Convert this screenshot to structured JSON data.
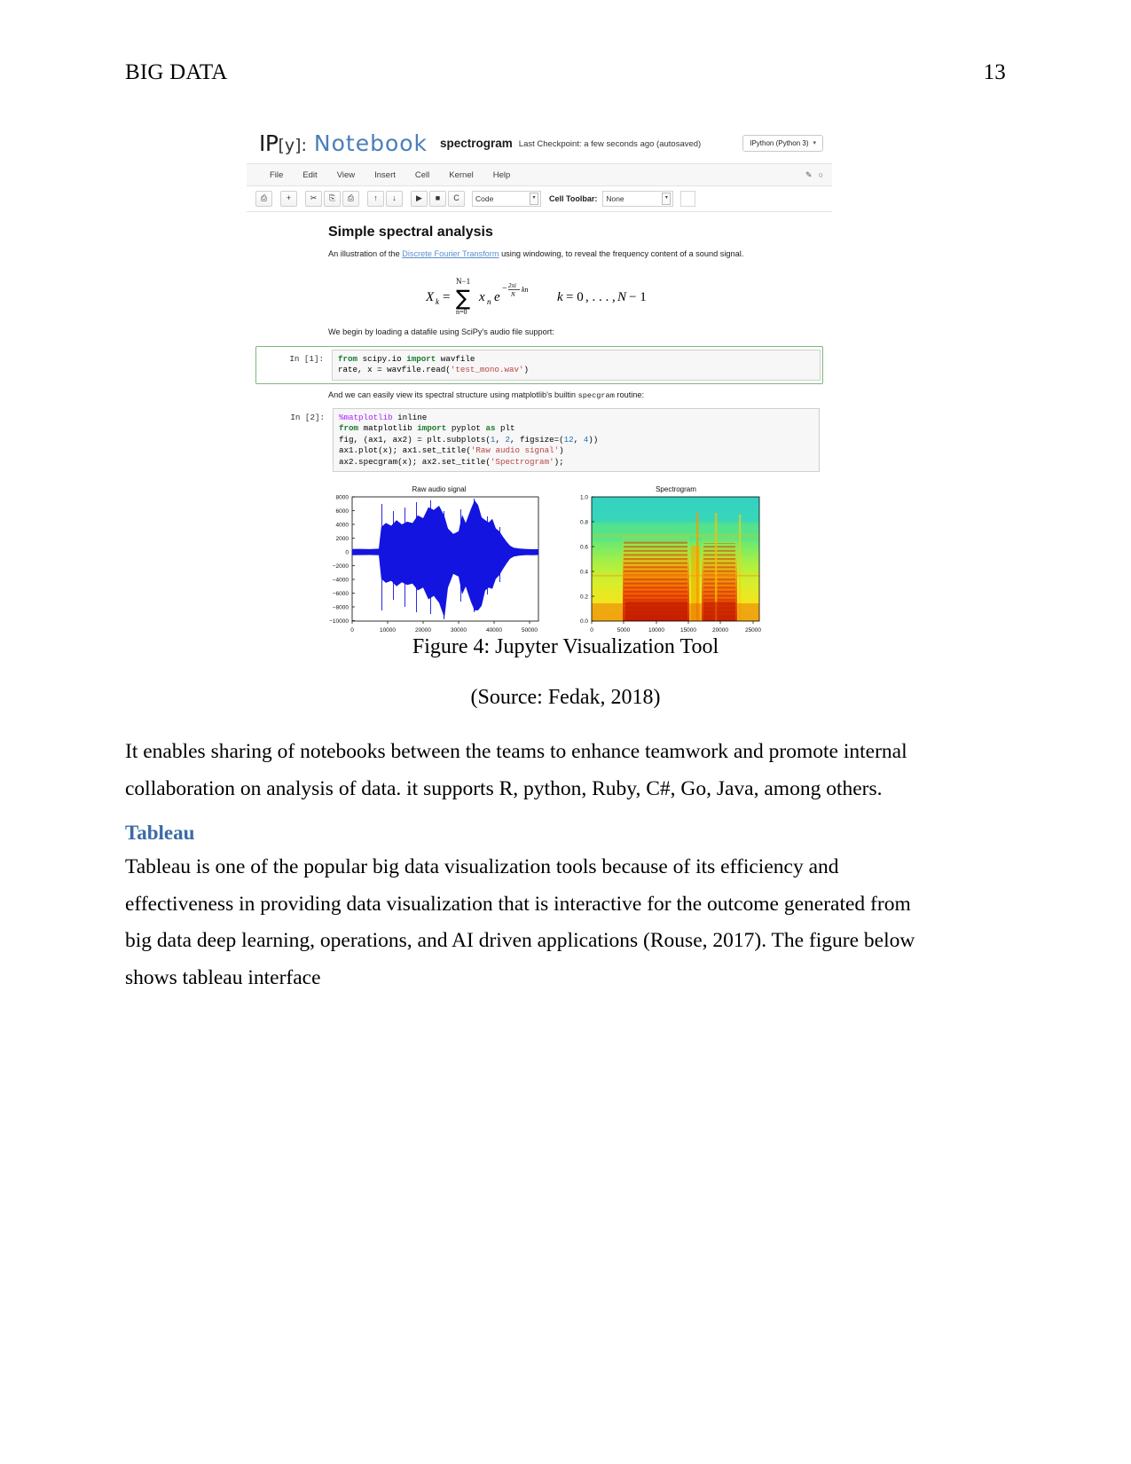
{
  "page": {
    "running_head": "BIG DATA",
    "page_number": "13"
  },
  "figure": {
    "caption": "Figure 4: Jupyter Visualization Tool",
    "source": "(Source: Fedak, 2018)",
    "notebook": {
      "logo_ip": "IP",
      "logo_bracket": "[y]:",
      "logo_word": "Notebook",
      "name": "spectrogram",
      "checkpoint": "Last Checkpoint: a few seconds ago (autosaved)",
      "kernel": "IPython (Python 3)",
      "kernel_caret": "▾",
      "menu": [
        "File",
        "Edit",
        "View",
        "Insert",
        "Cell",
        "Kernel",
        "Help"
      ],
      "tools_icons": [
        "pencil-icon",
        "circle-icon"
      ],
      "toolbar": {
        "buttons": [
          "save-icon",
          "add-icon",
          "cut-icon",
          "copy-icon",
          "paste-icon",
          "move-up-icon",
          "move-down-icon",
          "run-icon",
          "stop-icon",
          "restart-icon"
        ],
        "button_glyphs": [
          "⎙",
          "+",
          "✂",
          "⎘",
          "⎙",
          "↑",
          "↓",
          "▶",
          "■",
          "C"
        ],
        "cell_type": "Code",
        "cell_toolbar_label": "Cell Toolbar:",
        "cell_toolbar_value": "None"
      },
      "content": {
        "heading": "Simple spectral analysis",
        "intro_before": "An illustration of the ",
        "intro_link": "Discrete Fourier Transform",
        "intro_after": " using windowing, to reveal the frequency content of a sound signal.",
        "formula": {
          "lhs": "X",
          "lhs_sub": "k",
          "eq": "=",
          "sum_upper": "N−1",
          "sum_lower": "n=0",
          "term": "x",
          "term_sub": "n",
          "exp_base": "e",
          "exp_sign": "−",
          "exp_frac_num": "2πi",
          "exp_frac_den": "N",
          "exp_tail": "kn",
          "range": "k = 0, . . . , N − 1"
        },
        "para_loading": "We begin by loading a datafile using SciPy's audio file support:",
        "cell1_prompt": "In [1]:",
        "cell1_code": [
          {
            "parts": [
              [
                "kw",
                "from"
              ],
              [
                "plain",
                " scipy.io "
              ],
              [
                "kw",
                "import"
              ],
              [
                "plain",
                " wavfile"
              ]
            ]
          },
          {
            "parts": [
              [
                "plain",
                "rate, x = wavfile.read("
              ],
              [
                "str",
                "'test_mono.wav'"
              ],
              [
                "plain",
                ")"
              ]
            ]
          }
        ],
        "para_specgram_before": "And we can easily view its spectral structure using matplotlib's builtin ",
        "para_specgram_code": "specgram",
        "para_specgram_after": " routine:",
        "cell2_prompt": "In [2]:",
        "cell2_code": [
          {
            "parts": [
              [
                "magic",
                "%matplotlib"
              ],
              [
                "plain",
                " inline"
              ]
            ]
          },
          {
            "parts": [
              [
                "kw",
                "from"
              ],
              [
                "plain",
                " matplotlib "
              ],
              [
                "kw",
                "import"
              ],
              [
                "plain",
                " pyplot "
              ],
              [
                "kw",
                "as"
              ],
              [
                "plain",
                " plt"
              ]
            ]
          },
          {
            "parts": [
              [
                "plain",
                "fig, (ax1, ax2) = plt.subplots("
              ],
              [
                "num",
                "1"
              ],
              [
                "plain",
                ", "
              ],
              [
                "num",
                "2"
              ],
              [
                "plain",
                ", figsize=("
              ],
              [
                "num",
                "12"
              ],
              [
                "plain",
                ", "
              ],
              [
                "num",
                "4"
              ],
              [
                "plain",
                "))"
              ]
            ]
          },
          {
            "parts": [
              [
                "plain",
                "ax1.plot(x); ax1.set_title("
              ],
              [
                "str",
                "'Raw audio signal'"
              ],
              [
                "plain",
                ")"
              ]
            ]
          },
          {
            "parts": [
              [
                "plain",
                "ax2.specgram(x); ax2.set_title("
              ],
              [
                "str",
                "'Spectrogram'"
              ],
              [
                "plain",
                ");"
              ]
            ]
          }
        ]
      }
    }
  },
  "chart_data": [
    {
      "type": "line",
      "title": "Raw audio signal",
      "xlabel": "",
      "ylabel": "",
      "xlim": [
        0,
        52000
      ],
      "ylim": [
        -10000,
        8000
      ],
      "xticks": [
        0,
        10000,
        20000,
        30000,
        40000,
        50000
      ],
      "xtick_labels": [
        "0",
        "10000",
        "20000",
        "30000",
        "40000",
        "50000"
      ],
      "yticks": [
        -10000,
        -8000,
        -6000,
        -4000,
        -2000,
        0,
        2000,
        4000,
        6000,
        8000
      ],
      "ytick_labels": [
        "-10000",
        "-8000",
        "-6000",
        "-4000",
        "-2000",
        "0",
        "2000",
        "4000",
        "6000",
        "8000"
      ],
      "grid": false,
      "series_color": "#1414e0",
      "description": "Dense blue audio waveform; near-silent low amplitude at both edges, loud bursts between sample 8000 and 45000",
      "envelope_x": [
        0,
        2000,
        5000,
        7500,
        8200,
        9500,
        11000,
        12500,
        14000,
        15500,
        17000,
        18500,
        20000,
        21500,
        23000,
        24500,
        26000,
        27000,
        28500,
        30000,
        31000,
        32000,
        33500,
        34500,
        35500,
        36500,
        37500,
        38500,
        39500,
        40500,
        41500,
        42500,
        43500,
        44500,
        45500,
        47000,
        49000,
        51000
      ],
      "envelope_hi": [
        420,
        430,
        400,
        450,
        3600,
        4200,
        3800,
        4600,
        3900,
        4300,
        4100,
        5200,
        4800,
        6400,
        6000,
        6600,
        5200,
        3400,
        2600,
        3000,
        5400,
        4200,
        6300,
        7500,
        6800,
        5000,
        4600,
        4300,
        4800,
        3400,
        3000,
        2200,
        1500,
        900,
        600,
        500,
        430,
        400
      ],
      "envelope_lo": [
        -480,
        -470,
        -450,
        -500,
        -3900,
        -4500,
        -4200,
        -5000,
        -4400,
        -4800,
        -4600,
        -5600,
        -5200,
        -6900,
        -6400,
        -7400,
        -9600,
        -5200,
        -3200,
        -3600,
        -6200,
        -5000,
        -7300,
        -8500,
        -7800,
        -5600,
        -5200,
        -4800,
        -5400,
        -3900,
        -3400,
        -2500,
        -1700,
        -1000,
        -700,
        -560,
        -480,
        -450
      ]
    },
    {
      "type": "heatmap",
      "title": "Spectrogram",
      "xlabel": "",
      "ylabel": "",
      "xlim": [
        0,
        26000
      ],
      "ylim": [
        0.0,
        1.0
      ],
      "xticks": [
        0,
        5000,
        10000,
        15000,
        20000,
        25000
      ],
      "xtick_labels": [
        "0",
        "5000",
        "10000",
        "15000",
        "20000",
        "25000"
      ],
      "yticks": [
        0.0,
        0.2,
        0.4,
        0.6,
        0.8,
        1.0
      ],
      "ytick_labels": [
        "0.0",
        "0.2",
        "0.4",
        "0.6",
        "0.8",
        "1.0"
      ],
      "colormap": "jet",
      "colors": [
        "#2bd0c8",
        "#46e0a0",
        "#8ef060",
        "#d8f030",
        "#ffd400",
        "#ff9000",
        "#f04000",
        "#c01000"
      ],
      "description": "Jet-colormap spectrogram; cyan-green high-frequency background above 0.8, dense red/orange harmonic striations below 0.7 concentrated in two loud segments"
    }
  ],
  "body": {
    "paragraph_1": "It enables sharing of notebooks between the teams to enhance teamwork and promote internal collaboration on analysis of data. it supports R, python, Ruby, C#, Go, Java, among others.",
    "heading_tableau": "Tableau",
    "heading_color": "#3a6ba5",
    "paragraph_2": "Tableau is one of the popular big data visualization tools because of its efficiency and effectiveness in providing data visualization that is interactive for the outcome generated from big data deep learning, operations, and AI driven applications (Rouse, 2017). The figure below shows tableau interface"
  }
}
